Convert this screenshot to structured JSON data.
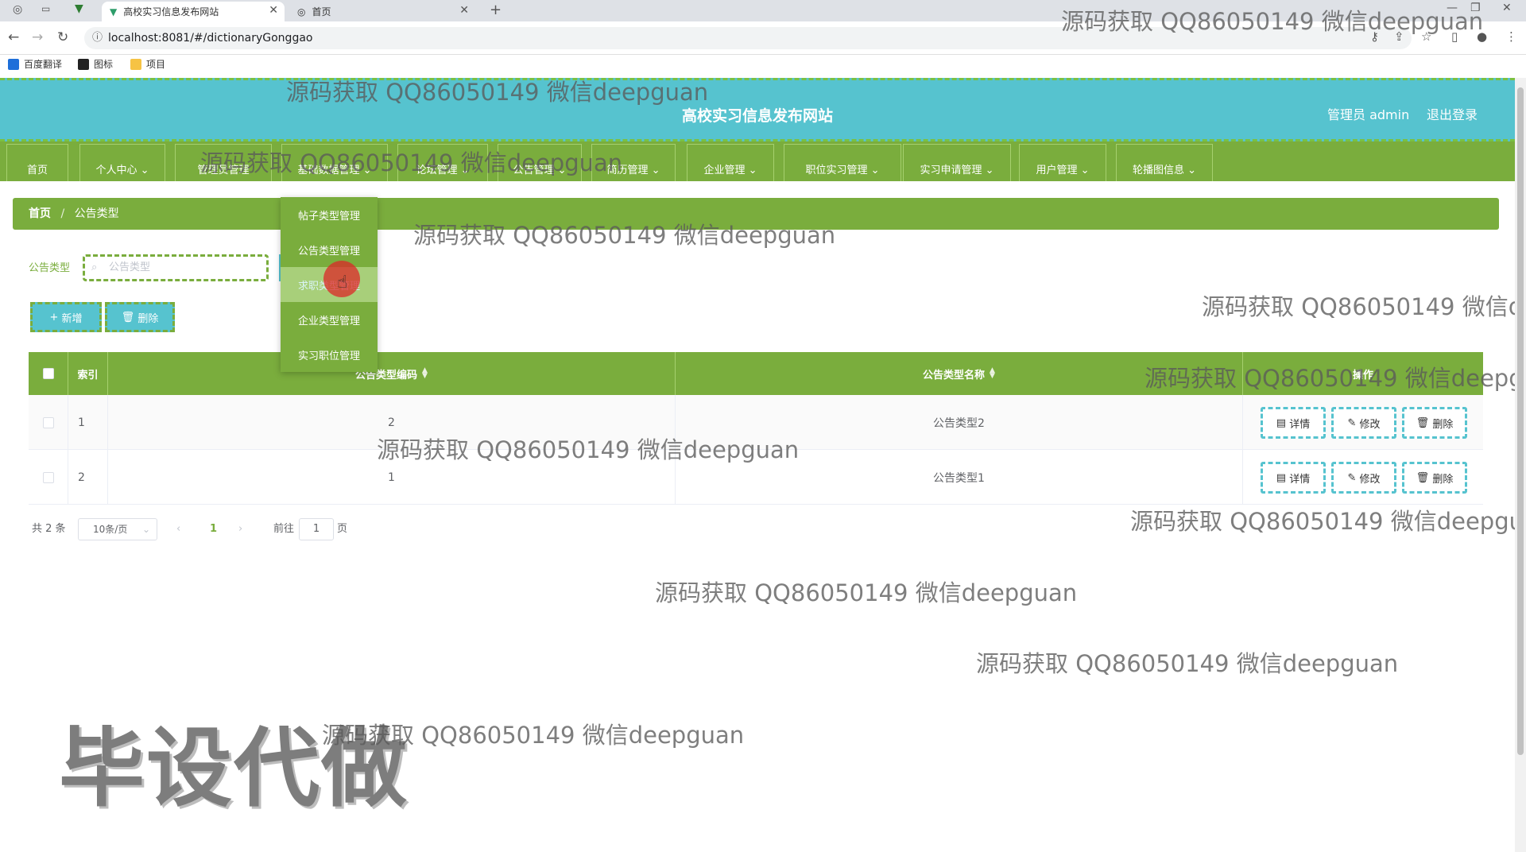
{
  "browser": {
    "tabs": [
      {
        "title": "高校实习信息发布网站",
        "active": true
      },
      {
        "title": "首页",
        "active": false
      }
    ],
    "url": "localhost:8081/#/dictionaryGonggao",
    "bookmarks": [
      "百度翻译",
      "图标",
      "项目"
    ]
  },
  "header": {
    "site_title": "高校实习信息发布网站",
    "admin_label": "管理员 admin",
    "logout": "退出登录"
  },
  "nav": {
    "items": [
      "首页",
      "个人中心",
      "管理员管理",
      "基础数据管理",
      "论坛管理",
      "公告管理",
      "简历管理",
      "企业管理",
      "职位实习管理",
      "实习申请管理",
      "用户管理",
      "轮播图信息"
    ]
  },
  "breadcrumb": {
    "home": "首页",
    "current": "公告类型"
  },
  "dropdown": {
    "items": [
      "帖子类型管理",
      "公告类型管理",
      "求职类型管理",
      "企业类型管理",
      "实习职位管理"
    ],
    "hovered_index": 2
  },
  "search": {
    "label": "公告类型",
    "placeholder": "公告类型"
  },
  "actions": {
    "add": "新增",
    "delete": "删除"
  },
  "table": {
    "headers": {
      "index": "索引",
      "code": "公告类型编码",
      "name": "公告类型名称",
      "ops": "操作"
    },
    "rows": [
      {
        "index": "1",
        "code": "2",
        "name": "公告类型2"
      },
      {
        "index": "2",
        "code": "1",
        "name": "公告类型1"
      }
    ],
    "row_buttons": {
      "detail": "详情",
      "edit": "修改",
      "delete": "删除"
    }
  },
  "pagination": {
    "total": "共 2 条",
    "page_size": "10条/页",
    "current_page": "1",
    "goto_label": "前往",
    "goto_value": "1",
    "page_unit": "页"
  },
  "watermarks": {
    "text": "源码获取 QQ86050149 微信deepguan",
    "big": "毕设代做"
  },
  "colors": {
    "primary_green": "#7aad3d",
    "header_cyan": "#56c3cf"
  }
}
